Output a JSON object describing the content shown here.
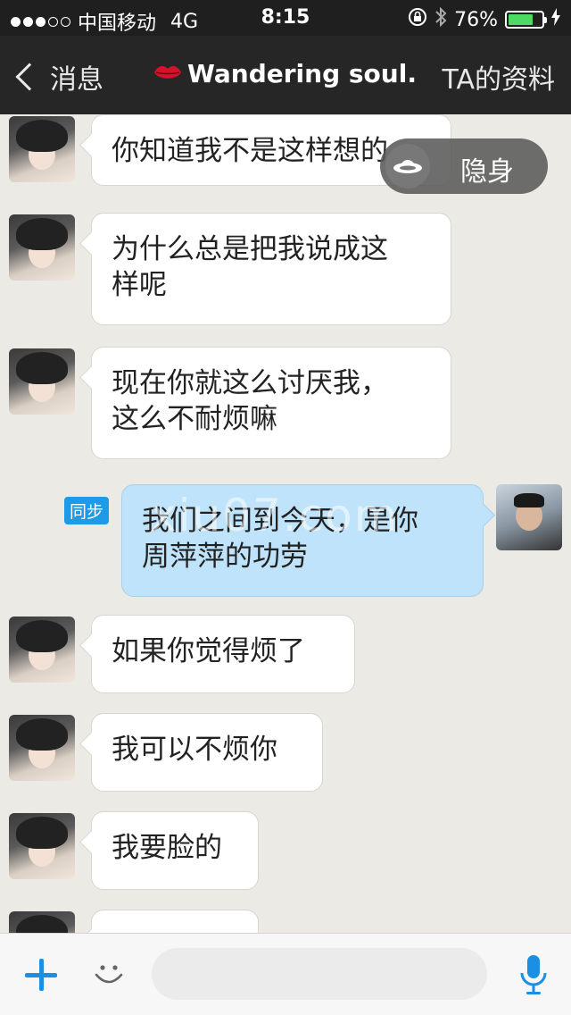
{
  "status_bar": {
    "carrier": "中国移动",
    "network": "4G",
    "time": "8:15",
    "battery": "76%",
    "battery_level": 0.76
  },
  "nav": {
    "back_label": "消息",
    "title": "Wandering soul.",
    "profile_label": "TA的资料"
  },
  "invisible_toggle": {
    "label": "隐身"
  },
  "messages": [
    {
      "side": "left",
      "line1": "你知道我不是这样想的"
    },
    {
      "side": "left",
      "line1": "为什么总是把我说成这",
      "line2": "样呢"
    },
    {
      "side": "left",
      "line1": "现在你就这么讨厌我，",
      "line2": "这么不耐烦嘛"
    },
    {
      "side": "right",
      "badge": "同步",
      "line1": "我们之间到今天，是你",
      "line2": "周萍萍的功劳"
    },
    {
      "side": "left",
      "line1": "如果你觉得烦了"
    },
    {
      "side": "left",
      "line1": "我可以不烦你"
    },
    {
      "side": "left",
      "line1": "我要脸的"
    }
  ],
  "watermark": "xiu07.com",
  "input": {
    "value": "",
    "placeholder": ""
  }
}
